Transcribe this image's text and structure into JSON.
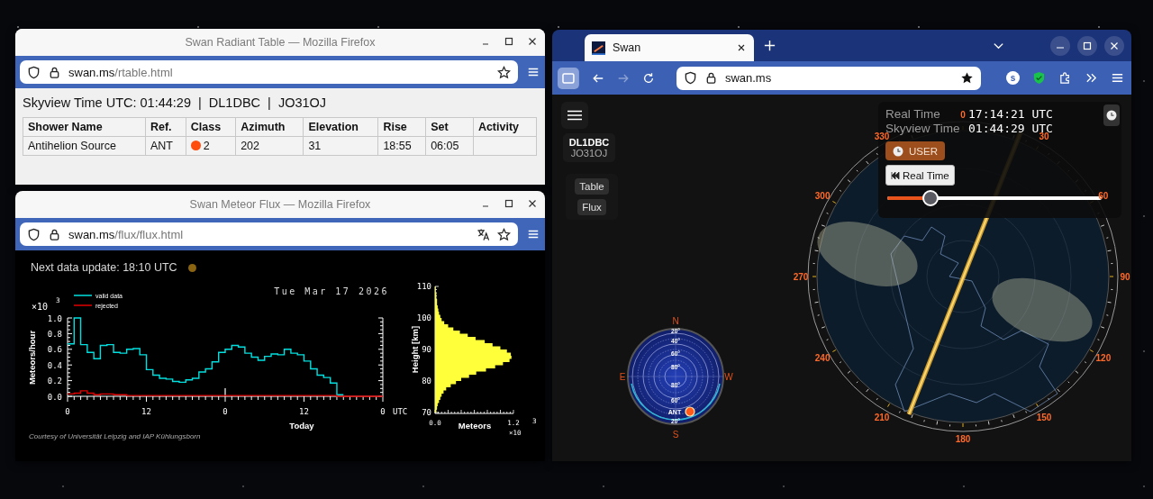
{
  "radiant_window": {
    "title": "Swan Radiant Table — Mozilla Firefox",
    "url_host": "swan.ms",
    "url_path": "/rtable.html",
    "header": "Skyview Time UTC: 01:44:29  |  DL1DBC  |  JO31OJ",
    "table": {
      "columns": [
        "Shower Name",
        "Ref.",
        "Class",
        "Azimuth",
        "Elevation",
        "Rise",
        "Set",
        "Activity"
      ],
      "rows": [
        {
          "cells": [
            "Antihelion Source",
            "ANT",
            "2",
            "202",
            "31",
            "18:55",
            "06:05"
          ],
          "color": "#ff4d0d"
        }
      ]
    }
  },
  "flux_window": {
    "title": "Swan Meteor Flux — Mozilla Firefox",
    "url_host": "swan.ms",
    "url_path": "/flux/flux.html",
    "update_text": "Next data update: 18:10 UTC",
    "flux_chart": {
      "date_title": "Tue Mar 17 2026",
      "day_label": "Today",
      "y_scale": "×10",
      "y_scale_exponent": "3",
      "x_unit": "UTC",
      "next_day_tick_labels": [
        "0",
        "12",
        "0"
      ],
      "chart_data": {
        "type": "line",
        "ylabel": "Meteors/hour",
        "legend": "upper left",
        "x": [
          0,
          1,
          1,
          2,
          2,
          3,
          3,
          4,
          4,
          5,
          5,
          6,
          6,
          7,
          7,
          8,
          8,
          9,
          9,
          10,
          10,
          11,
          11,
          12,
          12,
          13,
          13,
          14,
          14,
          15,
          15,
          16,
          16,
          17,
          17,
          18,
          18,
          19,
          19,
          20,
          20,
          21,
          21,
          22,
          22,
          23,
          23,
          24,
          24,
          25,
          25,
          26,
          26,
          27,
          27,
          28,
          28,
          29,
          29,
          30,
          30,
          31,
          31,
          32,
          32,
          33,
          33,
          34,
          34,
          35,
          35,
          36,
          36,
          37,
          37,
          38,
          38,
          39,
          39,
          40,
          40,
          41,
          41,
          42,
          42,
          43,
          43,
          44,
          44,
          45,
          45,
          46,
          46,
          47,
          47,
          48
        ],
        "series": [
          {
            "name": "valid data",
            "color": "#00e0e0",
            "values": [
              0.67,
              0.67,
              1.0,
              1.0,
              0.66,
              0.66,
              0.56,
              0.56,
              0.48,
              0.48,
              0.65,
              0.65,
              0.66,
              0.66,
              0.56,
              0.56,
              0.55,
              0.55,
              0.6,
              0.6,
              0.61,
              0.61,
              0.53,
              0.53,
              0.34,
              0.34,
              0.27,
              0.27,
              0.23,
              0.23,
              0.22,
              0.22,
              0.19,
              0.19,
              0.18,
              0.18,
              0.21,
              0.21,
              0.23,
              0.23,
              0.31,
              0.31,
              0.35,
              0.35,
              0.44,
              0.44,
              0.56,
              0.56,
              0.6,
              0.6,
              0.65,
              0.65,
              0.63,
              0.63,
              0.55,
              0.55,
              0.5,
              0.5,
              0.46,
              0.46,
              0.51,
              0.51,
              0.54,
              0.54,
              0.53,
              0.53,
              0.6,
              0.6,
              0.55,
              0.55,
              0.53,
              0.53,
              0.45,
              0.45,
              0.35,
              0.35,
              0.27,
              0.27,
              0.24,
              0.24,
              0.17,
              0.17,
              0.02,
              0.02,
              null,
              null,
              null,
              null,
              null,
              null,
              null,
              null,
              null,
              null,
              null,
              null
            ]
          },
          {
            "name": "rejected",
            "color": "#e00000",
            "values": [
              0.03,
              0.03,
              0.04,
              0.04,
              0.07,
              0.07,
              0.04,
              0.04,
              0.02,
              0.02,
              0.03,
              0.03,
              0.03,
              0.03,
              0.02,
              0.02,
              0.02,
              0.02,
              0.01,
              0.01,
              0.01,
              0.01,
              0.01,
              0.01,
              0.01,
              0.01,
              0.01,
              0.01,
              0.01,
              0.01,
              0.01,
              0.01,
              0.01,
              0.01,
              0.01,
              0.01,
              0.01,
              0.01,
              0.01,
              0.01,
              0.01,
              0.01,
              0.01,
              0.01,
              0.01,
              0.01,
              0.01,
              0.01,
              0.01,
              0.01,
              0.01,
              0.01,
              0.01,
              0.01,
              0.01,
              0.01,
              0.01,
              0.01,
              0.01,
              0.01,
              0.01,
              0.01,
              0.01,
              0.01,
              0.01,
              0.01,
              0.01,
              0.01,
              0.01,
              0.01,
              0.01,
              0.01,
              0.01,
              0.01,
              0.01,
              0.01,
              0.01,
              0.01,
              0.01,
              0.01,
              0.01,
              0.01,
              0.0,
              0.0,
              0.0,
              0.0,
              0.0,
              0.0,
              0.0,
              0.0,
              0.0,
              0.0,
              0.0,
              0.0,
              0.0,
              0.0
            ]
          }
        ],
        "xlim": [
          0,
          48
        ],
        "ylim": [
          0,
          1.0
        ],
        "xticks": [
          0,
          12
        ],
        "yticks": [
          {
            "value": 0,
            "label": "0.0"
          },
          {
            "value": 0.2,
            "label": "0.2"
          },
          {
            "value": 0.4,
            "label": "0.4"
          },
          {
            "value": 0.6,
            "label": "0.6"
          },
          {
            "value": 0.8,
            "label": "0.8"
          },
          {
            "value": 1.0,
            "label": "1.0"
          }
        ]
      }
    },
    "height_chart": {
      "y_scale": "×10",
      "y_scale_exponent": "3",
      "chart_data": {
        "type": "area",
        "orientation": "horizontal",
        "xlabel": "Meteors",
        "ylabel": "Height [km]",
        "x": [
          70,
          71,
          71,
          72,
          72,
          73,
          73,
          74,
          74,
          75,
          75,
          76,
          76,
          77,
          77,
          78,
          78,
          79,
          79,
          80,
          80,
          81,
          81,
          82,
          82,
          83,
          83,
          84,
          84,
          85,
          85,
          86,
          86,
          87,
          87,
          88,
          88,
          89,
          89,
          90,
          90,
          91,
          91,
          92,
          92,
          93,
          93,
          94,
          94,
          95,
          95,
          96,
          96,
          97,
          97,
          98,
          98,
          99,
          99,
          100,
          100,
          101,
          101,
          102,
          102,
          103,
          103,
          104,
          104,
          105,
          105,
          106,
          106,
          107,
          107,
          108,
          108,
          109,
          109,
          110
        ],
        "values": [
          0.02,
          0.02,
          0.03,
          0.03,
          0.04,
          0.04,
          0.06,
          0.06,
          0.08,
          0.08,
          0.1,
          0.1,
          0.13,
          0.13,
          0.17,
          0.17,
          0.24,
          0.24,
          0.32,
          0.32,
          0.4,
          0.4,
          0.52,
          0.52,
          0.63,
          0.63,
          0.78,
          0.78,
          0.92,
          0.92,
          1.04,
          1.04,
          1.14,
          1.14,
          1.17,
          1.17,
          1.16,
          1.16,
          1.1,
          1.1,
          1.0,
          1.0,
          0.88,
          0.88,
          0.76,
          0.76,
          0.62,
          0.62,
          0.5,
          0.5,
          0.38,
          0.38,
          0.28,
          0.28,
          0.2,
          0.2,
          0.14,
          0.14,
          0.1,
          0.1,
          0.08,
          0.08,
          0.06,
          0.06,
          0.05,
          0.05,
          0.04,
          0.04,
          0.03,
          0.03,
          0.03,
          0.03,
          0.02,
          0.02,
          0.02,
          0.02,
          0.01,
          0.01,
          0.01,
          0.01
        ],
        "xlim": [
          0,
          1.2
        ],
        "ylim": [
          70,
          110
        ],
        "xticks": [
          {
            "value": 0,
            "label": "0.0"
          },
          {
            "value": 1.2,
            "label": "1.2"
          }
        ],
        "yticks": [
          70,
          80,
          90,
          100,
          110
        ]
      }
    },
    "credit": "Courtesy of Universität Leipzig and IAP Kühlungsborn"
  },
  "swan_window": {
    "tab_title": "Swan",
    "url": "swan.ms",
    "account_letter": "s",
    "forward_disabled": true,
    "station": {
      "callsign": "DL1DBC",
      "locator": "JO31OJ"
    },
    "nav_buttons": [
      "Table",
      "Flux"
    ],
    "time_panel": {
      "rows": [
        {
          "label": "Real Time",
          "value": "17:14:21 UTC"
        },
        {
          "label": "Skyview Time",
          "value": "01:44:29 UTC"
        }
      ],
      "mode_button": "USER",
      "reset_button": "Real Time",
      "slider": {
        "level": 0.2
      }
    },
    "azimuth_labels": [
      "0",
      "30",
      "60",
      "90",
      "120",
      "150",
      "180",
      "210",
      "240",
      "270",
      "300",
      "330"
    ],
    "compass": {
      "directions": [
        "N",
        "E",
        "W",
        "S"
      ],
      "elevation_labels": [
        "20°",
        "40°",
        "60°",
        "80°",
        "80°",
        "60°",
        "20°"
      ],
      "radiant_label": "ANT"
    }
  }
}
